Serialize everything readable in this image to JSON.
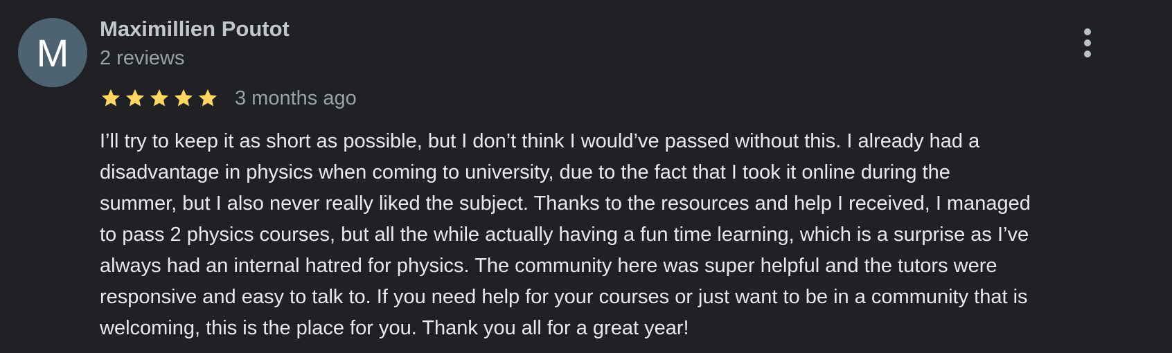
{
  "review": {
    "avatar_letter": "M",
    "author": "Maximillien Poutot",
    "review_count": "2 reviews",
    "rating": 5,
    "rating_max": 5,
    "date": "3 months ago",
    "star_color": "#fdd663",
    "text_lines": [
      "I’ll try to keep it as short as possible, but I don’t think I would’ve passed without this. I already had a",
      "disadvantage in physics when coming to university, due to the fact that I took it online during the",
      "summer, but I also never really liked the subject. Thanks to the resources and help I received, I managed",
      "to pass 2 physics courses, but all the while actually having a fun time learning, which is a surprise as I’ve",
      "always had an internal hatred for physics. The community here was super helpful and the tutors were",
      "responsive and easy to talk to. If you need help for your courses or just want to be in a community that is",
      "welcoming, this is the place for you. Thank you all for a great year!"
    ]
  },
  "icons": {
    "more": "more-vert-icon",
    "star": "star-icon"
  },
  "colors": {
    "background": "#202124",
    "avatar_bg": "#4e6372",
    "primary_text": "#e8eaed",
    "secondary_text": "#9aa0a6"
  }
}
